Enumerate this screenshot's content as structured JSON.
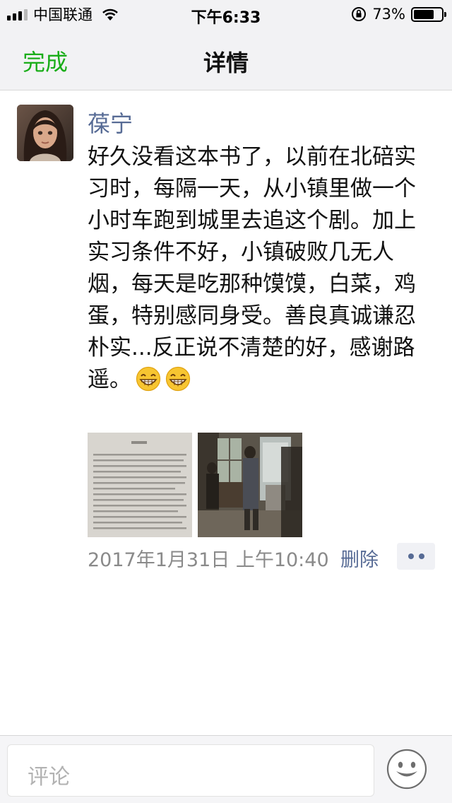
{
  "status_bar": {
    "carrier": "中国联通",
    "time": "下午6:33",
    "battery": "73%",
    "battery_level": 0.73
  },
  "nav": {
    "done_label": "完成",
    "title": "详情"
  },
  "post": {
    "author": "葆宁",
    "text": "好久没看这本书了，以前在北碚实习时，每隔一天，从小镇里做一个小时车跑到城里去追这个剧。加上实习条件不好，小镇破败几无人烟，每天是吃那种馍馍，白菜，鸡蛋，特别感同身受。善良真诚谦忍朴实...反正说不清楚的好，感谢路遥。",
    "emoji": [
      "grin-emoji",
      "grin-emoji"
    ],
    "photos": [
      "book-page-photo",
      "tv-drama-still-photo"
    ],
    "timestamp": "2017年1月31日 上午10:40",
    "delete_label": "删除"
  },
  "comment": {
    "placeholder": "评论"
  },
  "colors": {
    "accent_green": "#1aad19",
    "link_blue": "#576b95",
    "meta_gray": "#8a8a8a"
  }
}
